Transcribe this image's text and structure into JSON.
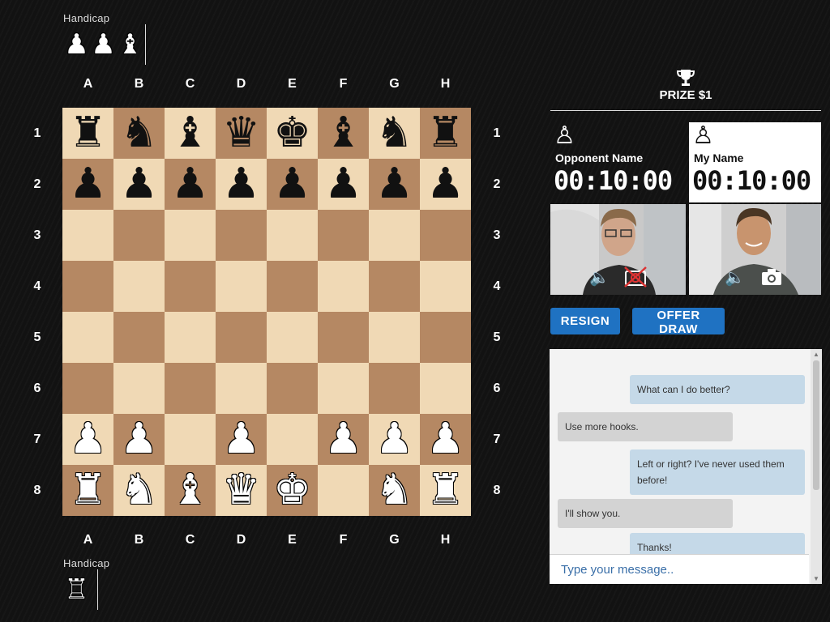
{
  "top_handicap": {
    "label": "Handicap",
    "pieces": [
      "♟",
      "♟",
      "♝"
    ]
  },
  "bottom_handicap": {
    "label": "Handicap",
    "pieces": [
      "♖"
    ]
  },
  "board": {
    "files": [
      "A",
      "B",
      "C",
      "D",
      "E",
      "F",
      "G",
      "H"
    ],
    "ranks": [
      "1",
      "2",
      "3",
      "4",
      "5",
      "6",
      "7",
      "8"
    ],
    "rows": [
      [
        "br",
        "bn",
        "bb",
        "bq",
        "bk",
        "bb",
        "bn",
        "br"
      ],
      [
        "bp",
        "bp",
        "bp",
        "bp",
        "bp",
        "bp",
        "bp",
        "bp"
      ],
      [
        "",
        "",
        "",
        "",
        "",
        "",
        "",
        ""
      ],
      [
        "",
        "",
        "",
        "",
        "",
        "",
        "",
        ""
      ],
      [
        "",
        "",
        "",
        "",
        "",
        "",
        "",
        ""
      ],
      [
        "",
        "",
        "",
        "",
        "",
        "",
        "",
        ""
      ],
      [
        "wp",
        "wp",
        "",
        "wp",
        "",
        "wp",
        "wp",
        "wp"
      ],
      [
        "wr",
        "wn",
        "wb",
        "wq",
        "wk",
        "",
        "wn",
        "wr"
      ]
    ],
    "colors": {
      "light": "#f0d9b5",
      "dark": "#b58863"
    }
  },
  "prize": {
    "label": "PRIZE $1",
    "icon": "trophy-icon"
  },
  "opponent": {
    "name": "Opponent Name",
    "clock": "00:10:00",
    "icon": "pawn-icon"
  },
  "me": {
    "name": "My Name",
    "clock": "00:10:00",
    "icon": "pawn-icon"
  },
  "controls": {
    "resign": "RESIGN",
    "offer_draw": "OFFER DRAW",
    "accent": "#1f72c2"
  },
  "chat": {
    "messages": [
      {
        "from": "me",
        "text": "What can I do better?"
      },
      {
        "from": "opponent",
        "text": "Use more hooks."
      },
      {
        "from": "me",
        "text": "Left or right? I've never used them before!"
      },
      {
        "from": "opponent",
        "text": "I'll show you."
      },
      {
        "from": "me",
        "text": "Thanks!"
      }
    ],
    "placeholder": "Type your message.."
  }
}
